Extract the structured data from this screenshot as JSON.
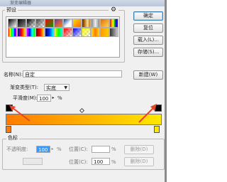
{
  "window": {
    "title": "渐变编辑器"
  },
  "presets": {
    "legend": "预设",
    "menu_icon": "gear-icon",
    "swatches": [
      "linear-gradient(135deg,#000 0%,#fff 100%)",
      "linear-gradient(135deg,#000 0%,#888 100%)",
      "checker:#000",
      "checker:#444",
      "linear-gradient(135deg,#ff0000 0%,#00a000 100%)",
      "linear-gradient(135deg,#7a2fa0 0%,#ff8a00 100%)",
      "linear-gradient(135deg,#0a3f9a 0%,#ffffff 60%)",
      "linear-gradient(135deg,#ffdd00 0%,#ff6600 100%)",
      "linear-gradient(90deg,#5a2b00,#c07a2a,#ffe08a,#c07a2a)",
      "linear-gradient(90deg,#888,#eee,#888)",
      "linear-gradient(135deg,#e07000 0%,#ffd35a 100%)",
      "linear-gradient(90deg,#ff0000,#ff8800,#ffff00,#00cc00,#0000ff,#8800ff)",
      "linear-gradient(90deg,#ff0000,#ffff00,#00ff00,#00ffff,#0000ff,#ff00ff)",
      "linear-gradient(90deg,#0000ff,#ff0000,#ffff00)",
      "linear-gradient(90deg,#ff00ff,#0000ff,#00ffff,#00ff00)",
      "linear-gradient(90deg,#6a0000,#ff0000,#ffee00)",
      "linear-gradient(90deg,#00005a,#0033ff,#00ffff)",
      "linear-gradient(90deg,#ff0,#0f0,#0ff)",
      "checker:#ff0000",
      "checker:#0000ff",
      "checker:#ffff00",
      "linear-gradient(90deg,#ffe000,#ff7a00,#ffe000)",
      "linear-gradient(90deg,#ff9900,#ffcc00)",
      "linear-gradient(90deg,#333,#ccc)"
    ]
  },
  "buttons": {
    "ok": "确定",
    "reset": "复位",
    "load": "载入(L)...",
    "save": "存储(S)...",
    "new": "新建(W)"
  },
  "name_row": {
    "label": "名称(N):",
    "value": "自定"
  },
  "gradient_type": {
    "label": "渐变类型(T):",
    "value": "实底"
  },
  "smoothness": {
    "label": "平滑度(M):",
    "value": "100",
    "unit": "%"
  },
  "gradient": {
    "colors": [
      "#ff7a00",
      "#ffe800"
    ],
    "opacity_stop_icon": "opacity-stop-icon",
    "color_stop_icon": "color-stop-icon",
    "midpoint_icon": "midpoint-diamond-icon"
  },
  "annotations": {
    "arrow_color": "#e8442a"
  },
  "color_stops": {
    "legend": "色标",
    "opacity_label": "不透明度:",
    "opacity_value": "100",
    "opacity_unit": "%",
    "location_label": "位置(C):",
    "location_value": "100",
    "location_unit": "%",
    "delete_label": "删除(D)"
  }
}
